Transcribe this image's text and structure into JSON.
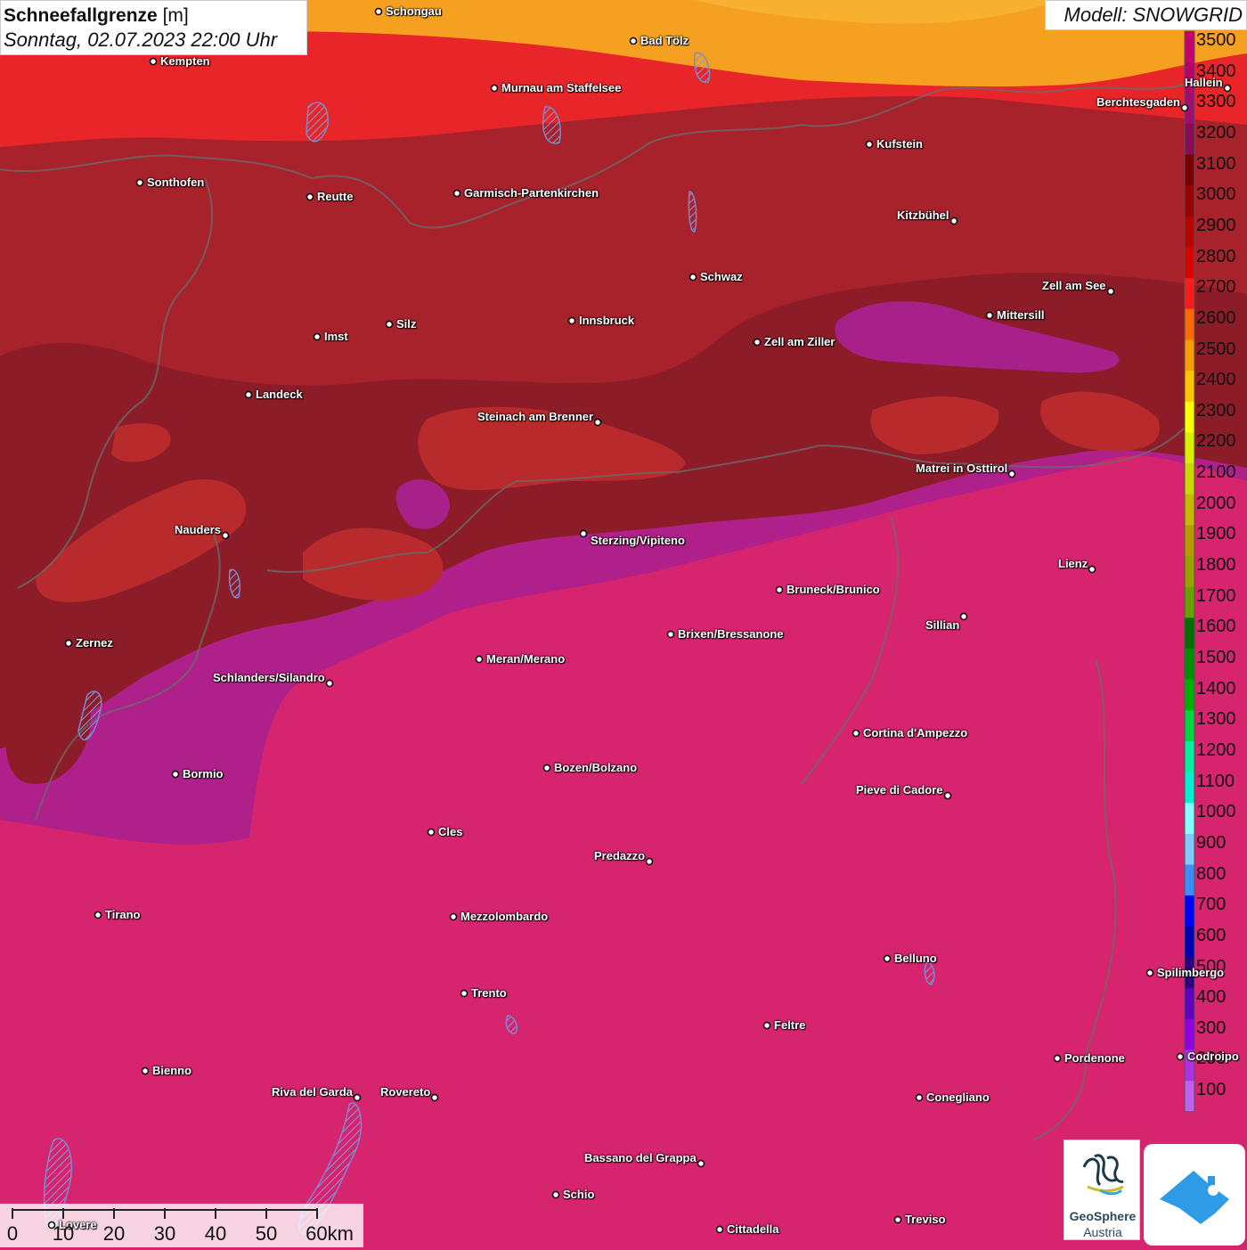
{
  "header": {
    "title": "Schneefallgrenze",
    "unit": "[m]",
    "datetime": "Sonntag, 02.07.2023 22:00 Uhr",
    "model": "Modell: SNOWGRID"
  },
  "legend": {
    "entries": [
      {
        "label": "3500",
        "color": "#c8006c"
      },
      {
        "label": "3400",
        "color": "#b8006a"
      },
      {
        "label": "3300",
        "color": "#a10d6e"
      },
      {
        "label": "3200",
        "color": "#8a0a58"
      },
      {
        "label": "3100",
        "color": "#7a0000"
      },
      {
        "label": "3000",
        "color": "#990000"
      },
      {
        "label": "2900",
        "color": "#bb0000"
      },
      {
        "label": "2800",
        "color": "#dd0000"
      },
      {
        "label": "2700",
        "color": "#ff1a1a"
      },
      {
        "label": "2600",
        "color": "#ff6a00"
      },
      {
        "label": "2500",
        "color": "#ff9a00"
      },
      {
        "label": "2400",
        "color": "#ffc400"
      },
      {
        "label": "2300",
        "color": "#ffff00"
      },
      {
        "label": "2200",
        "color": "#d8f000"
      },
      {
        "label": "2100",
        "color": "#c8d800"
      },
      {
        "label": "2000",
        "color": "#c8b800"
      },
      {
        "label": "1900",
        "color": "#b89a00"
      },
      {
        "label": "1800",
        "color": "#9aa000"
      },
      {
        "label": "1700",
        "color": "#6aa000"
      },
      {
        "label": "1600",
        "color": "#007000"
      },
      {
        "label": "1500",
        "color": "#009000"
      },
      {
        "label": "1400",
        "color": "#00b000"
      },
      {
        "label": "1300",
        "color": "#00d840"
      },
      {
        "label": "1200",
        "color": "#00f0a0"
      },
      {
        "label": "1100",
        "color": "#00f0d0"
      },
      {
        "label": "1000",
        "color": "#80ffff"
      },
      {
        "label": "900",
        "color": "#80c8ff"
      },
      {
        "label": "800",
        "color": "#3a8cff"
      },
      {
        "label": "700",
        "color": "#0000ff"
      },
      {
        "label": "600",
        "color": "#0000b0"
      },
      {
        "label": "500",
        "color": "#300080"
      },
      {
        "label": "400",
        "color": "#6000c0"
      },
      {
        "label": "300",
        "color": "#9000e0"
      },
      {
        "label": "200",
        "color": "#b030e8"
      },
      {
        "label": "100",
        "color": "#c060f0"
      }
    ]
  },
  "cities": [
    {
      "name": "Schongau"
    },
    {
      "name": "Bad Tölz"
    },
    {
      "name": "Kempten"
    },
    {
      "name": "Murnau am Staffelsee"
    },
    {
      "name": "Hallein"
    },
    {
      "name": "Berchtesgaden"
    },
    {
      "name": "Kufstein"
    },
    {
      "name": "Sonthofen"
    },
    {
      "name": "Reutte"
    },
    {
      "name": "Garmisch-Partenkirchen"
    },
    {
      "name": "Kitzbühel"
    },
    {
      "name": "Schwaz"
    },
    {
      "name": "Zell am See"
    },
    {
      "name": "Mittersill"
    },
    {
      "name": "Innsbruck"
    },
    {
      "name": "Zell am Ziller"
    },
    {
      "name": "Imst"
    },
    {
      "name": "Silz"
    },
    {
      "name": "Landeck"
    },
    {
      "name": "Steinach am Brenner"
    },
    {
      "name": "Matrei in Osttirol"
    },
    {
      "name": "Nauders"
    },
    {
      "name": "Sterzing/Vipiteno"
    },
    {
      "name": "Lienz"
    },
    {
      "name": "Bruneck/Brunico"
    },
    {
      "name": "Sillian"
    },
    {
      "name": "Zernez"
    },
    {
      "name": "Brixen/Bressanone"
    },
    {
      "name": "Meran/Merano"
    },
    {
      "name": "Schlanders/Silandro"
    },
    {
      "name": "Cortina d'Ampezzo"
    },
    {
      "name": "Bozen/Bolzano"
    },
    {
      "name": "Bormio"
    },
    {
      "name": "Pieve di Cadore"
    },
    {
      "name": "Cles"
    },
    {
      "name": "Predazzo"
    },
    {
      "name": "Tirano"
    },
    {
      "name": "Mezzolombardo"
    },
    {
      "name": "Belluno"
    },
    {
      "name": "Spilimbergo"
    },
    {
      "name": "Trento"
    },
    {
      "name": "Feltre"
    },
    {
      "name": "Pordenone"
    },
    {
      "name": "Codroipo"
    },
    {
      "name": "Bienno"
    },
    {
      "name": "Riva del Garda"
    },
    {
      "name": "Rovereto"
    },
    {
      "name": "Conegliano"
    },
    {
      "name": "Bassano del Grappa"
    },
    {
      "name": "Schio"
    },
    {
      "name": "Lovere"
    },
    {
      "name": "Treviso"
    },
    {
      "name": "Cittadella"
    }
  ],
  "scale": {
    "labels": [
      "0",
      "10",
      "20",
      "30",
      "40",
      "50",
      "60km"
    ]
  },
  "logos": {
    "geosphere_name": "GeoSphere",
    "geosphere_country": "Austria"
  },
  "colors": {
    "band_orange": "#f5a020",
    "band_red": "#e8262a",
    "band_darkred": "#a8222c",
    "band_maroon": "#8c1c28",
    "band_purple": "#b0208a",
    "band_magenta": "#d6246f",
    "app_icon": "#2e9be6"
  }
}
